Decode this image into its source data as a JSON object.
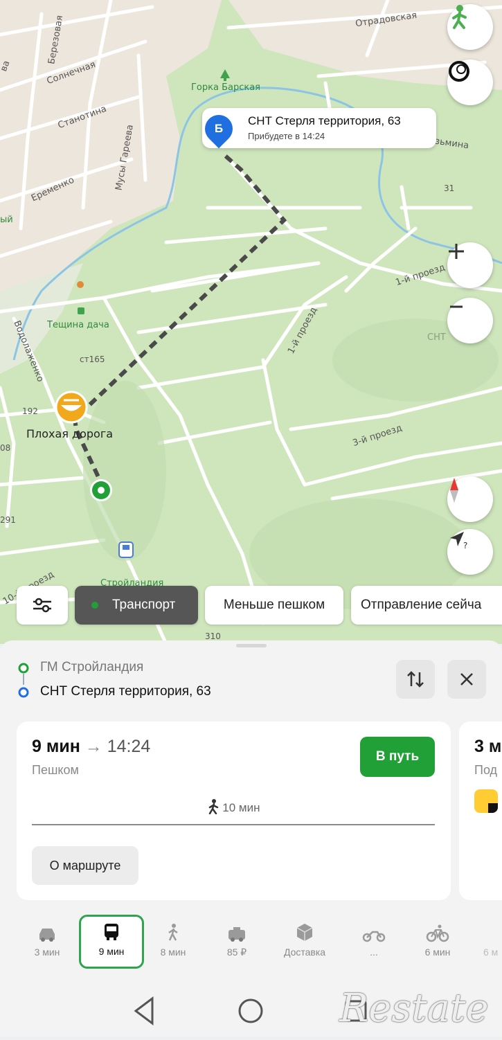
{
  "map": {
    "labels": {
      "otradovskaya": "Отрадовская",
      "berezovaya": "Березовая",
      "solnechnaya": "Солнечная",
      "stanotina": "Станотина",
      "eremenko": "Еременко",
      "musy_gareeva": "Мусы Гареева",
      "gorka_barskaya": "Горка Барская",
      "kuzmina": "зьмина",
      "n31": "31",
      "proezd1a": "1-й проезд",
      "proezd1b": "1-й проезд",
      "proezd3": "3-й проезд",
      "sht": "СНТ",
      "teshchina_dacha": "Тещина дача",
      "st165": "ст165",
      "vodolazhenko": "Водолаженко",
      "n192": "192",
      "plohaya_doroga": "Плохая дорога",
      "n08": "08",
      "n291": "291",
      "proezd10": "10-й проезд",
      "stroylandia": "Стройландия",
      "n310": "310",
      "yy": "ый",
      "va": "ва"
    },
    "destination_bubble": {
      "pin_letter": "Б",
      "title": "СНТ Стерля территория, 63",
      "subtitle": "Прибудете в 14:24"
    }
  },
  "chips": {
    "transport": "Транспорт",
    "less_walking": "Меньше пешком",
    "departure": "Отправление сейча"
  },
  "route": {
    "from": "ГМ Стройландия",
    "to": "СНТ Стерля территория, 63"
  },
  "card": {
    "duration": "9 мин",
    "arrow": "→",
    "arrival": "14:24",
    "mode": "Пешком",
    "go_button": "В путь",
    "walk_segment": "10 мин",
    "details_button": "О маршруте"
  },
  "card_peek": {
    "duration": "3 м",
    "mode": "Под"
  },
  "modes": [
    {
      "name": "car",
      "label": "3 мин"
    },
    {
      "name": "bus",
      "label": "9 мин"
    },
    {
      "name": "walk",
      "label": "8 мин"
    },
    {
      "name": "taxi",
      "label": "85 ₽"
    },
    {
      "name": "delivery",
      "label": "Доставка"
    },
    {
      "name": "moto",
      "label": "..."
    },
    {
      "name": "bike",
      "label": "6 мин"
    },
    {
      "name": "scooter",
      "label": "6 м"
    }
  ],
  "watermark": "Restate",
  "colors": {
    "accent_green": "#21a038",
    "pin_blue": "#1f6fe0",
    "route_dash": "#4a4a4a"
  }
}
